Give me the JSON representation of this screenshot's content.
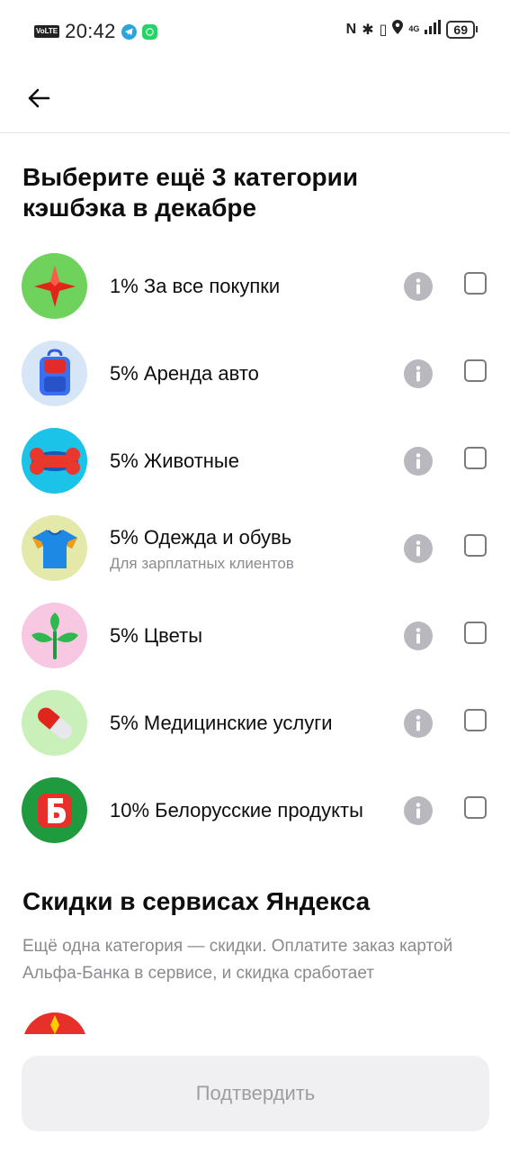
{
  "status_bar": {
    "volte": "VoLTE",
    "time": "20:42",
    "network": "4G",
    "battery": "69"
  },
  "page": {
    "title": "Выберите ещё 3 категории кэшбэка в декабре"
  },
  "categories": [
    {
      "label": "1% За все покупки",
      "sub": "",
      "icon": "red-star-icon",
      "bg": "#6fd25c"
    },
    {
      "label": "5% Аренда авто",
      "sub": "",
      "icon": "blue-luggage-icon",
      "bg": "#d6e6f7"
    },
    {
      "label": "5% Животные",
      "sub": "",
      "icon": "bone-icon",
      "bg": "#1bc3e8"
    },
    {
      "label": "5% Одежда и обувь",
      "sub": "Для зарплатных клиентов",
      "icon": "tshirt-icon",
      "bg": "#e4e8a8"
    },
    {
      "label": "5% Цветы",
      "sub": "",
      "icon": "sprout-icon",
      "bg": "#f8c8e2"
    },
    {
      "label": "5% Медицинские услуги",
      "sub": "",
      "icon": "pill-icon",
      "bg": "#c8f0b8"
    },
    {
      "label": "10% Белорусские продукты",
      "sub": "",
      "icon": "belarus-b-logo-icon",
      "bg": "#1f9a3e"
    }
  ],
  "yandex": {
    "title": "Скидки в сервисах Яндекса",
    "description": "Ещё одна категория — скидки. Оплатите заказ картой Альфа-Банка в сервисе, и скидка сработает"
  },
  "confirm_label": "Подтвердить"
}
